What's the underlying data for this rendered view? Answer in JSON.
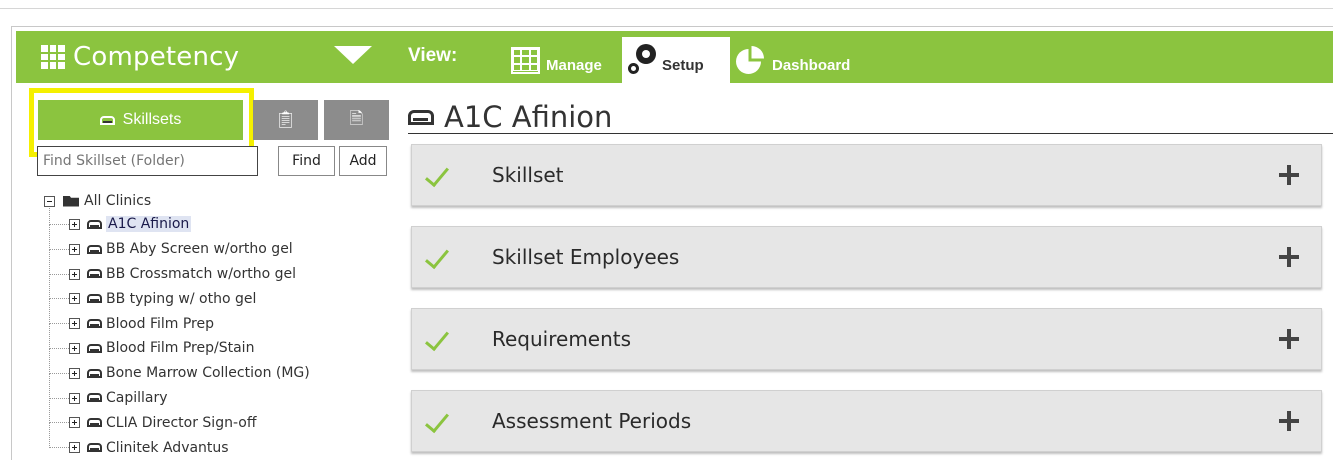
{
  "header": {
    "app_title": "Competency",
    "view_label": "View:",
    "tabs": [
      {
        "label": "Manage",
        "icon": "grid-table-icon"
      },
      {
        "label": "Setup",
        "icon": "gears-icon",
        "active": true
      },
      {
        "label": "Dashboard",
        "icon": "pie-chart-icon"
      }
    ],
    "accent_color": "#8bc43f"
  },
  "left": {
    "tabs": [
      {
        "label": "Skillsets",
        "icon": "tray-icon",
        "active": true
      },
      {
        "label": "",
        "icon": "clipboard-icon"
      },
      {
        "label": "",
        "icon": "document-icon"
      }
    ],
    "search": {
      "placeholder": "Find Skillset (Folder)",
      "value": ""
    },
    "find_label": "Find",
    "add_label": "Add",
    "tree": {
      "root": "All Clinics",
      "items": [
        "A1C Afinion",
        "BB Aby Screen w/ortho gel",
        "BB Crossmatch w/ortho gel",
        "BB typing w/ otho gel",
        "Blood Film Prep",
        "Blood Film Prep/Stain",
        "Bone Marrow Collection (MG)",
        "Capillary",
        "CLIA Director Sign-off",
        "Clinitek Advantus"
      ],
      "selected": "A1C Afinion"
    }
  },
  "main": {
    "title": "A1C Afinion",
    "panels": [
      {
        "title": "Skillset"
      },
      {
        "title": "Skillset Employees"
      },
      {
        "title": "Requirements"
      },
      {
        "title": "Assessment Periods"
      }
    ]
  }
}
